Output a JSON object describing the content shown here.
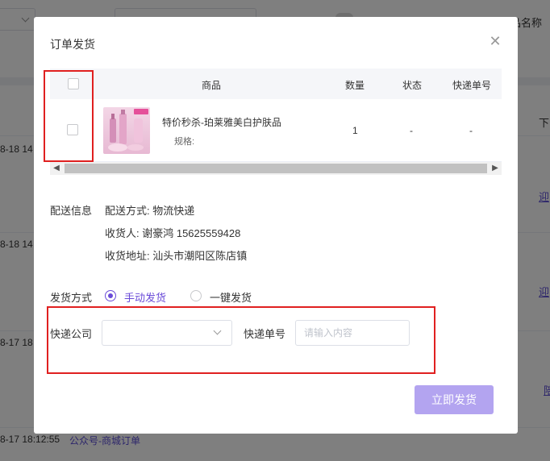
{
  "background": {
    "header_filter_label": "商品名称",
    "right_column_header": "下",
    "rows": [
      {
        "time_fragment": "8-18 14"
      },
      {
        "time_fragment": "8-18 14"
      },
      {
        "time_fragment": "8-17 18"
      }
    ],
    "bottom_row": {
      "time": "8-17 18:12:55",
      "source": "公众号-商城订单"
    },
    "row_links": [
      "迎",
      "迎",
      "陪"
    ]
  },
  "modal": {
    "title": "订单发货",
    "close_icon": "close-icon",
    "table": {
      "headers": {
        "product": "商品",
        "quantity": "数量",
        "status": "状态",
        "tracking_no": "快递单号"
      },
      "rows": [
        {
          "product_name": "特价秒杀-珀莱雅美白护肤品",
          "spec_label": "规格:",
          "quantity": "1",
          "status": "-",
          "tracking_no": "-"
        }
      ]
    },
    "delivery_info": {
      "section_label": "配送信息",
      "method": "配送方式: 物流快递",
      "receiver": "收货人: 谢豪鸿 15625559428",
      "address": "收货地址: 汕头市潮阳区陈店镇"
    },
    "ship_method": {
      "label": "发货方式",
      "options": [
        {
          "label": "手动发货",
          "selected": true
        },
        {
          "label": "一键发货",
          "selected": false
        }
      ]
    },
    "express": {
      "company_label": "快递公司",
      "company_value": "",
      "tracking_label": "快递单号",
      "tracking_placeholder": "请输入内容",
      "tracking_value": ""
    },
    "submit_label": "立即发货"
  },
  "colors": {
    "accent": "#6a4bd8",
    "button_disabled": "#b3a4f0",
    "highlight_red": "#e02020",
    "link": "#5b4cd6"
  }
}
